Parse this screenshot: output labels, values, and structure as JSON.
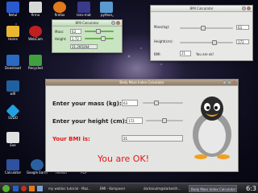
{
  "desktop_icons": [
    {
      "label": "Netul",
      "color": "#2a5ad0"
    },
    {
      "label": "firma",
      "color": "#d8d8d8"
    },
    {
      "label": "firefox",
      "color": "#e07a1a"
    },
    {
      "label": "lens-mat",
      "color": "#3a3a8a"
    },
    {
      "label": "python",
      "color": "#5a9ad0"
    },
    {
      "label": "Home",
      "color": "#e8b830"
    },
    {
      "label": "WebCam",
      "color": "#c02020"
    },
    {
      "label": "Download",
      "color": "#2a6ac0"
    },
    {
      "label": "Recycled",
      "color": "#40a040"
    },
    {
      "label": "wifi",
      "color": "#2060a0"
    },
    {
      "label": "SUDO",
      "color": "#20a0e0"
    },
    {
      "label": "Exe",
      "color": "#e0e0e0"
    },
    {
      "label": "Calculator",
      "color": "#3050a0"
    },
    {
      "label": "Google Earth",
      "color": "#2a60a0"
    },
    {
      "label": "redvon",
      "color": "#c03030"
    },
    {
      "label": "PDF",
      "color": "#e02020"
    }
  ],
  "small_window": {
    "title": "BMI Calculator",
    "mass_label": "Mass:",
    "mass_value": "63",
    "height_label": "Height:",
    "height_value": "1.72",
    "result_value": "21.295294"
  },
  "right_window": {
    "title": "BMI Calculator",
    "mass_label": "Mass(kg):",
    "mass_value": "63",
    "height_label": "Height(cm):",
    "height_value": "172",
    "bmi_label": "BMI:",
    "bmi_value": "21",
    "bmi_message": "You are ok!"
  },
  "main_window": {
    "title": "Body Mass Index Calculator",
    "mass_label": "Enter your mass (kg):",
    "mass_value": "63",
    "height_label": "Enter your height (cm):",
    "height_value": "172",
    "bmi_label": "Your BMI is:",
    "bmi_value": "21",
    "message": "You are OK!",
    "message_color": "#e01818"
  },
  "taskbar": {
    "items": [
      "my weblos tutorial - Moz...",
      "BMI - Komposer",
      "darksoulm@darkesth...",
      "Body Mass Index Calculator"
    ],
    "clock": "6:3"
  }
}
